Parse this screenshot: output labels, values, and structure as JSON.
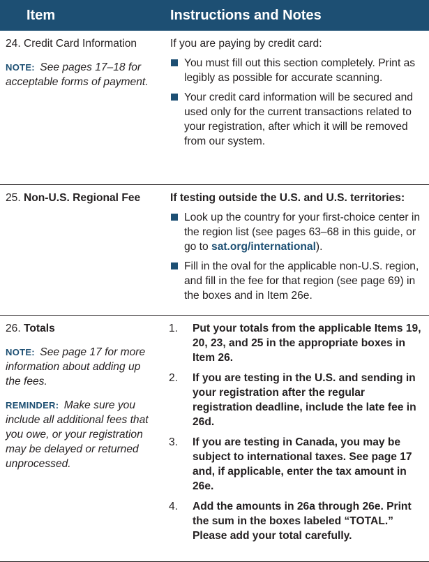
{
  "header": {
    "item": "Item",
    "notes": "Instructions and Notes"
  },
  "row24": {
    "num": "24.",
    "title": "Credit Card Information",
    "note_label": "NOTE:",
    "note_text": "See pages 17–18 for acceptable forms of payment.",
    "intro": "If you are paying by credit card:",
    "bullets": [
      "You must fill out this section completely. Print as legibly as possible for accurate scanning.",
      "Your credit card information will be secured and used only for the current transactions related to your registration, after which it will be removed from our system."
    ]
  },
  "row25": {
    "num": "25.",
    "title": "Non-U.S. Regional Fee",
    "intro": "If testing outside the U.S. and U.S. territories:",
    "bullet1_before": "Look up the country for your first-choice center in the region list (see pages 63–68 in this guide, or go to ",
    "bullet1_link": "sat.org/international",
    "bullet1_after": ").",
    "bullet2": "Fill in the oval for the applicable non-U.S. region, and fill in the fee for that region (see page 69) in the boxes and in Item 26e."
  },
  "row26": {
    "num": "26.",
    "title": "Totals",
    "note_label": "NOTE:",
    "note_text": "See page 17 for more information about adding up the fees.",
    "reminder_label": "REMINDER:",
    "reminder_text": "Make sure you include all additional fees that you owe, or your registration may be delayed or returned unprocessed.",
    "steps": [
      {
        "num": "1.",
        "text": "Put your totals from the applicable Items 19, 20, 23, and 25 in the appropriate boxes in Item 26."
      },
      {
        "num": "2.",
        "text": "If you are testing in the U.S. and sending in your registration after the regular registration deadline, include the late fee in 26d."
      },
      {
        "num": "3.",
        "text": "If you are testing in Canada, you may be subject to international taxes. See page 17 and, if applicable, enter the tax amount in 26e."
      },
      {
        "num": "4.",
        "text": "Add the amounts in 26a through 26e. Print the sum in the boxes labeled “TOTAL.” Please add your total carefully."
      }
    ]
  }
}
